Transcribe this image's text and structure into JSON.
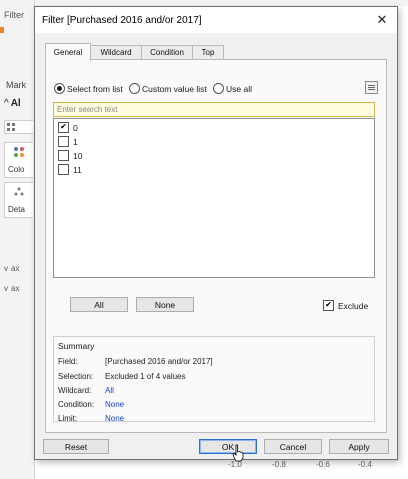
{
  "background": {
    "filters_label": "Filter",
    "marks_label": "Mark",
    "all_label": "Al",
    "color_tile_label": "Colo",
    "detail_tile_label": "Deta",
    "row1_label": "ax",
    "row2_label": "ax",
    "axis_ticks": [
      "-1.0",
      "-0.8",
      "-0.6",
      "-0.4"
    ],
    "accent_color": "#e8862b"
  },
  "dialog": {
    "title": "Filter [Purchased 2016 and/or 2017]",
    "close_icon": "close-icon",
    "tabs": [
      {
        "label": "General",
        "active": true
      },
      {
        "label": "Wildcard",
        "active": false
      },
      {
        "label": "Condition",
        "active": false
      },
      {
        "label": "Top",
        "active": false
      }
    ],
    "modes": [
      {
        "label": "Select from list",
        "selected": true
      },
      {
        "label": "Custom value list",
        "selected": false
      },
      {
        "label": "Use all",
        "selected": false
      }
    ],
    "list_button_icon": "list-icon",
    "search": {
      "placeholder": "Enter search text",
      "value": ""
    },
    "values": [
      {
        "label": "0",
        "checked": true
      },
      {
        "label": "1",
        "checked": false
      },
      {
        "label": "10",
        "checked": false
      },
      {
        "label": "11",
        "checked": false
      }
    ],
    "all_button": "All",
    "none_button": "None",
    "exclude": {
      "label": "Exclude",
      "checked": true
    },
    "summary": {
      "title": "Summary",
      "field_label": "Field:",
      "field_value": "[Purchased 2016 and/or 2017]",
      "selection_label": "Selection:",
      "selection_value": "Excluded 1 of 4 values",
      "wildcard_label": "Wildcard:",
      "wildcard_value": "All",
      "condition_label": "Condition:",
      "condition_value": "None",
      "limit_label": "Limit:",
      "limit_value": "None"
    },
    "buttons": {
      "reset": "Reset",
      "ok": "OK",
      "cancel": "Cancel",
      "apply": "Apply"
    },
    "link_color": "#1c3fd2",
    "default_button_border": "#2b6fd0"
  }
}
